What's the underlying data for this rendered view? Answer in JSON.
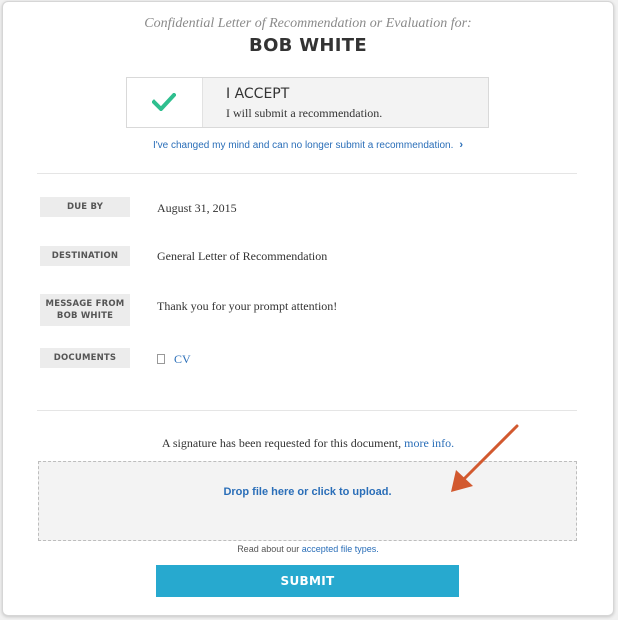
{
  "header": {
    "subtitle": "Confidential Letter of Recommendation or Evaluation for:",
    "name": "BOB WHITE"
  },
  "accept": {
    "title": "I ACCEPT",
    "subtitle": "I will submit a recommendation.",
    "icon": "checkmark-icon",
    "check_color": "#2fbf8f"
  },
  "decline_link": "I've changed my mind and can no longer submit a recommendation.",
  "details": {
    "due_by_label": "DUE BY",
    "due_by_value": "August 31, 2015",
    "destination_label": "DESTINATION",
    "destination_value": "General Letter of Recommendation",
    "message_label_line1": "MESSAGE FROM",
    "message_label_line2": "BOB WHITE",
    "message_value": "Thank you for your prompt attention!",
    "documents_label": "DOCUMENTS",
    "documents": [
      {
        "name": "CV",
        "icon": "document-icon"
      }
    ]
  },
  "signature": {
    "text": "A signature has been requested for this document,",
    "more_info": "more info."
  },
  "upload": {
    "dropzone_label": "Drop file here or click to upload.",
    "read_about": "Read about our",
    "accepted_types_link": "accepted file types."
  },
  "submit_label": "SUBMIT",
  "colors": {
    "accent": "#27a9cf",
    "link": "#2a6eb8",
    "arrow": "#d2592f"
  }
}
